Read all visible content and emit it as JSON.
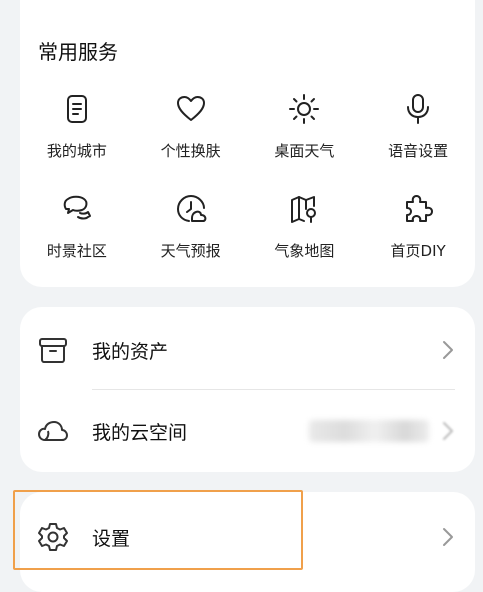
{
  "services": {
    "title": "常用服务",
    "items": [
      {
        "label": "我的城市",
        "icon": "document-icon"
      },
      {
        "label": "个性换肤",
        "icon": "heart-icon"
      },
      {
        "label": "桌面天气",
        "icon": "sun-icon"
      },
      {
        "label": "语音设置",
        "icon": "microphone-icon"
      },
      {
        "label": "时景社区",
        "icon": "chat-bubbles-icon"
      },
      {
        "label": "天气预报",
        "icon": "clock-cloud-icon"
      },
      {
        "label": "气象地图",
        "icon": "map-icon"
      },
      {
        "label": "首页DIY",
        "icon": "puzzle-icon"
      }
    ]
  },
  "assets": {
    "my_assets_label": "我的资产",
    "my_cloud_label": "我的云空间"
  },
  "settings": {
    "label": "设置"
  },
  "colors": {
    "highlight_border": "#f0a04b",
    "card_bg": "#ffffff",
    "page_bg": "#f1f3f5"
  }
}
